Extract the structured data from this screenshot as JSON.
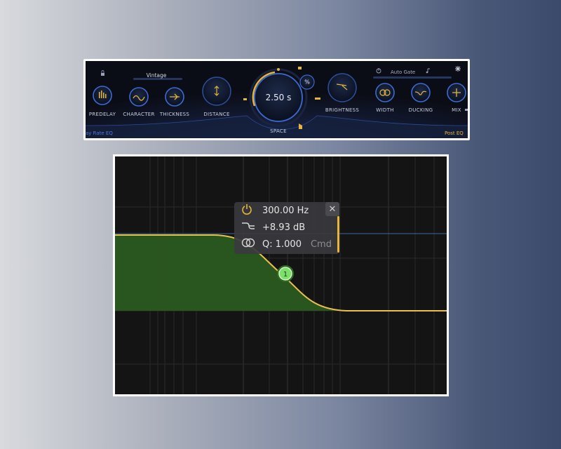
{
  "plugin": {
    "preset": "Vintage",
    "autogate_label": "Auto Gate",
    "space_value": "2.50 s",
    "space_percent_label": "%",
    "left_eq_label": "ay Rate EQ",
    "right_eq_label": "Post EQ",
    "knobs": {
      "predelay": "PREDELAY",
      "character": "CHARACTER",
      "thickness": "THICKNESS",
      "distance": "DISTANCE",
      "space": "SPACE",
      "brightness": "BRIGHTNESS",
      "width": "WIDTH",
      "ducking": "DUCKING",
      "mix": "MIX"
    },
    "colors": {
      "accent": "#e6b53a",
      "ring": "#3d6bd0",
      "background": "#0d0f18"
    }
  },
  "eq": {
    "band_number": "1",
    "frequency": "300.00 Hz",
    "gain": "+8.93 dB",
    "q": "Q: 1.000",
    "modifier_hint": "Cmd",
    "close_label": "✕",
    "colors": {
      "curve": "#e8c24a",
      "fill": "#2a5a1f",
      "node": "#7de06a",
      "zero_line": "#3a6a9a"
    }
  }
}
